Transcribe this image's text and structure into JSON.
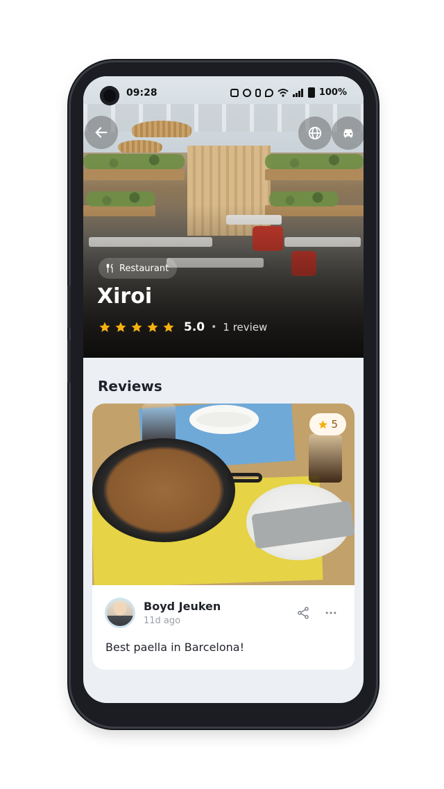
{
  "status_bar": {
    "time": "09:28",
    "battery": "100%"
  },
  "place": {
    "category": "Restaurant",
    "name": "Xiroi",
    "rating": "5.0",
    "separator": "•",
    "review_count": "1 review",
    "stars": 5
  },
  "reviews": {
    "heading": "Reviews",
    "items": [
      {
        "photo_rating": "5",
        "author": "Boyd Jeuken",
        "time": "11d ago",
        "text": "Best paella in Barcelona!"
      }
    ]
  },
  "icons": {
    "back": "arrow-left-icon",
    "website": "globe-icon",
    "directions": "car-icon",
    "category": "fork-knife-icon",
    "star": "star-icon",
    "share": "share-icon",
    "more": "more-horizontal-icon"
  },
  "colors": {
    "star": "#f5b014",
    "background": "#eceff4",
    "card": "#ffffff",
    "text": "#1f2329"
  }
}
